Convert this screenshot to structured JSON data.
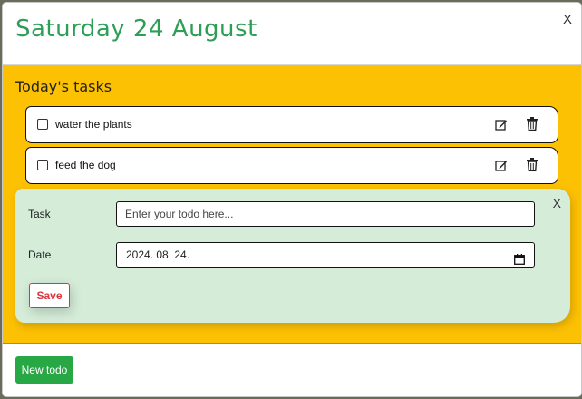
{
  "modal": {
    "title": "Saturday 24 August",
    "close_label": "X"
  },
  "tasks_section": {
    "title": "Today's tasks",
    "tasks": [
      {
        "text": "water the plants",
        "done": false
      },
      {
        "text": "feed the dog",
        "done": false
      }
    ]
  },
  "form": {
    "close_label": "X",
    "task_label": "Task",
    "task_placeholder": "Enter your todo here...",
    "date_label": "Date",
    "date_value": "2024. 08. 24.",
    "save_label": "Save"
  },
  "footer": {
    "new_todo_label": "New todo"
  },
  "colors": {
    "title_green": "#2e9e57",
    "body_yellow": "#fdc104",
    "form_green": "#d4ecd8",
    "save_red": "#d9363e",
    "button_green": "#28a745"
  },
  "icons": [
    "edit-icon",
    "trash-icon",
    "calendar-icon"
  ]
}
